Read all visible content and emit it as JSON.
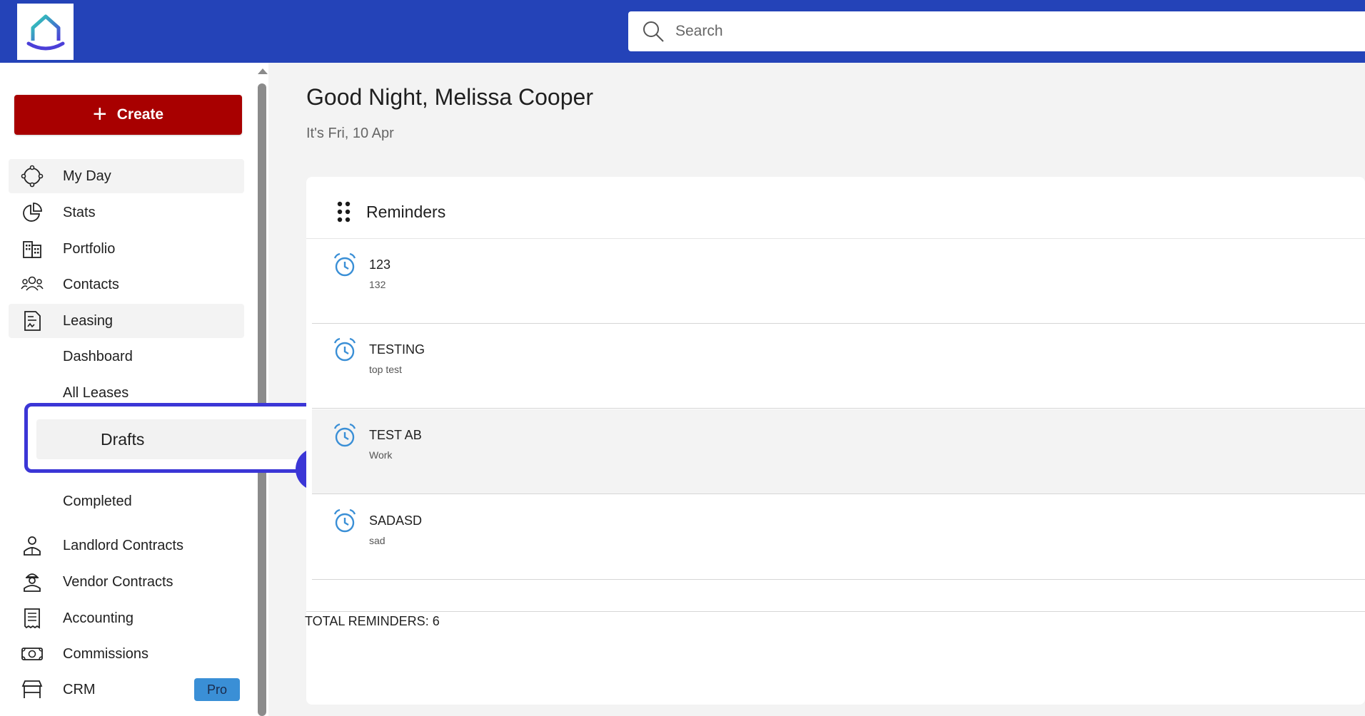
{
  "header": {
    "search_placeholder": "Search"
  },
  "sidebar": {
    "create_label": "Create",
    "items": [
      {
        "label": "My Day",
        "icon": "my-day-icon"
      },
      {
        "label": "Stats",
        "icon": "pie-chart-icon"
      },
      {
        "label": "Portfolio",
        "icon": "buildings-icon"
      },
      {
        "label": "Contacts",
        "icon": "people-icon"
      },
      {
        "label": "Leasing",
        "icon": "lease-document-icon"
      },
      {
        "label": "Landlord Contracts",
        "icon": "landlord-icon"
      },
      {
        "label": "Vendor Contracts",
        "icon": "vendor-icon"
      },
      {
        "label": "Accounting",
        "icon": "receipt-icon"
      },
      {
        "label": "Commissions",
        "icon": "money-icon"
      },
      {
        "label": "CRM",
        "icon": "store-icon",
        "badge": "Pro"
      }
    ],
    "leasing_sub": [
      "Dashboard",
      "All Leases",
      "Drafts",
      "Completed"
    ]
  },
  "main": {
    "greeting": "Good Night, Melissa Cooper",
    "date": "It's Fri, 10 Apr",
    "reminders": {
      "title": "Reminders",
      "items": [
        {
          "title": "123",
          "subtitle": "132"
        },
        {
          "title": "TESTING",
          "subtitle": "top test"
        },
        {
          "title": "TEST AB",
          "subtitle": "Work"
        },
        {
          "title": "SADASD",
          "subtitle": "sad"
        }
      ],
      "total": "TOTAL REMINDERS: 6"
    }
  },
  "colors": {
    "topbar": "#2443b8",
    "create": "#a80000",
    "highlight": "#3b36d6",
    "pro_badge": "#3a8fd6"
  }
}
